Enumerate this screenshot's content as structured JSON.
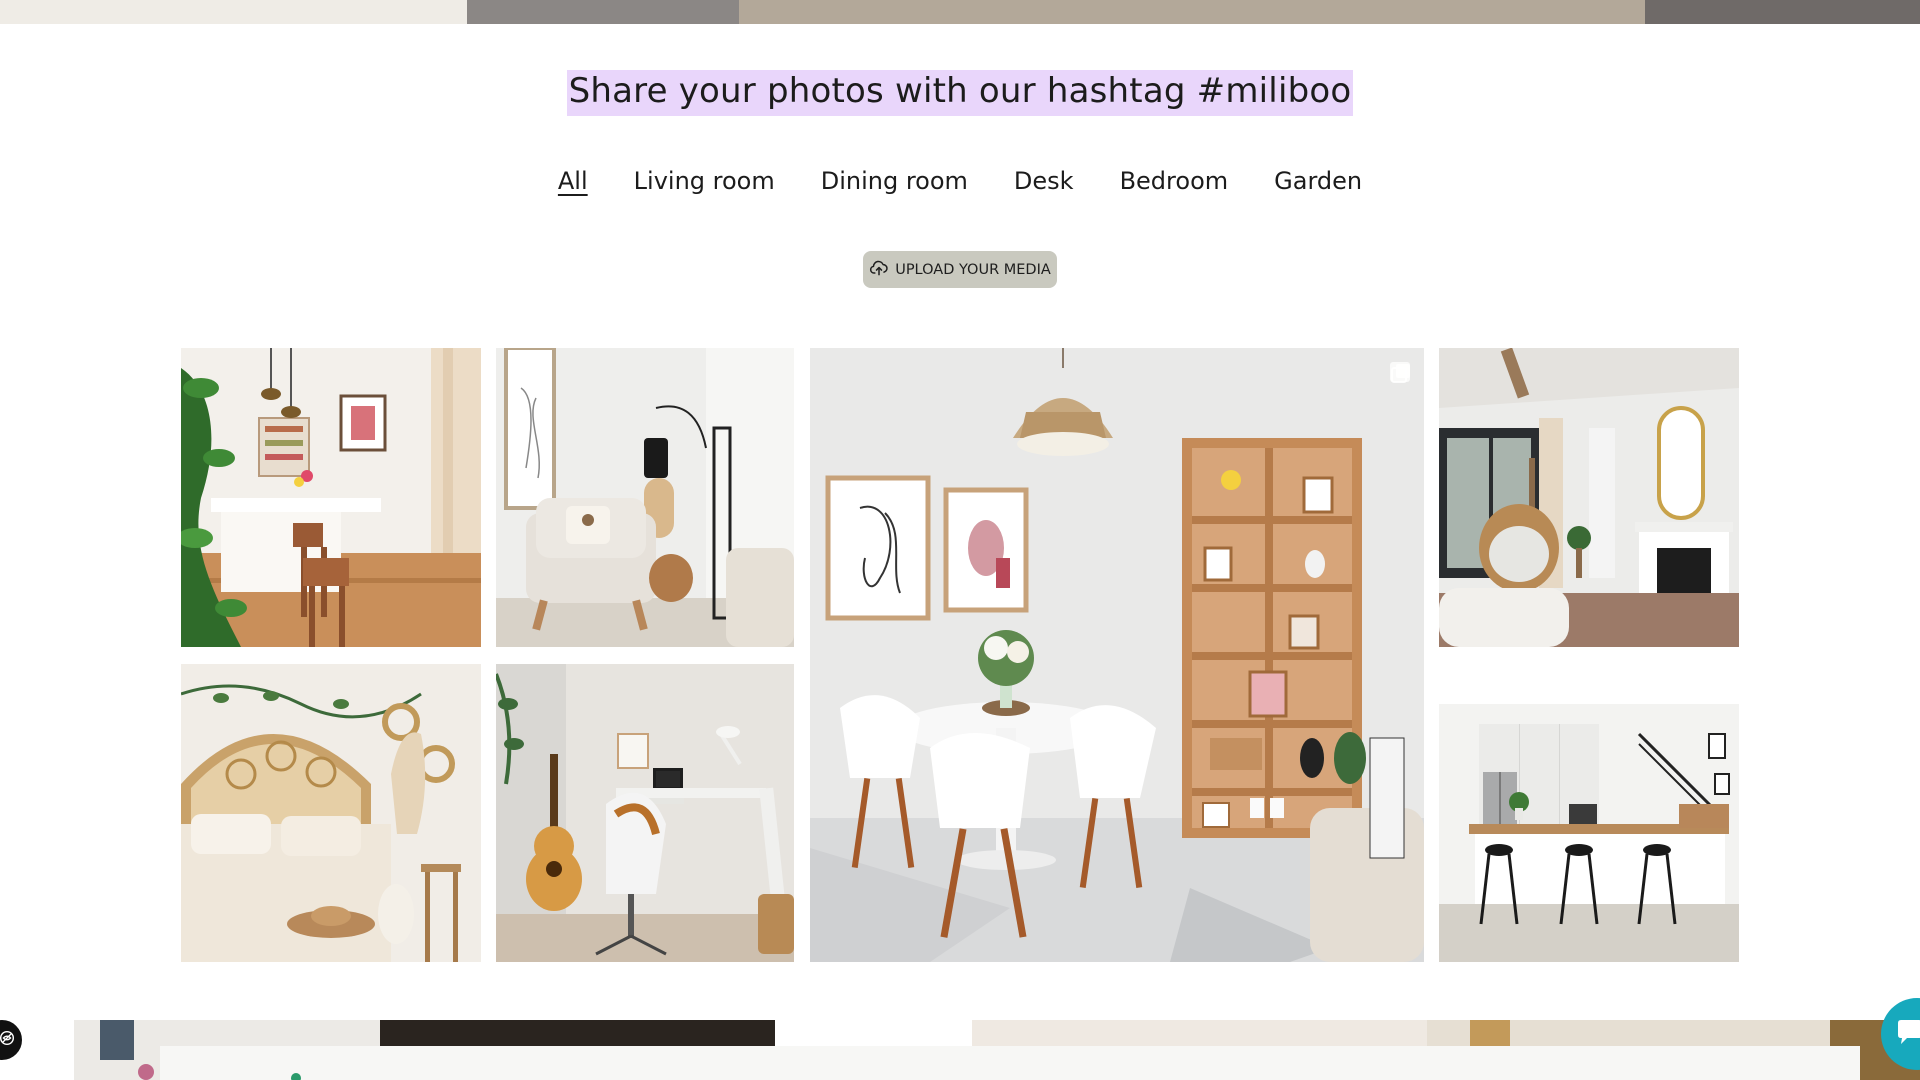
{
  "gallery": {
    "headline": "Share your photos with our hashtag #miliboo",
    "filters": [
      {
        "label": "All",
        "active": true
      },
      {
        "label": "Living room",
        "active": false
      },
      {
        "label": "Dining room",
        "active": false
      },
      {
        "label": "Desk",
        "active": false
      },
      {
        "label": "Bedroom",
        "active": false
      },
      {
        "label": "Garden",
        "active": false
      }
    ],
    "upload_label": "UPLOAD YOUR MEDIA",
    "upload_icon": "cloud-upload-icon",
    "photos": [
      {
        "name": "photo-kitchen-bar",
        "subject": "kitchen breakfast bar with wooden stools"
      },
      {
        "name": "photo-armchair-corner",
        "subject": "reading corner with beige armchair"
      },
      {
        "name": "photo-dining-room",
        "subject": "dining room with round white table and bookshelf",
        "badge_icon": "multi-image-icon"
      },
      {
        "name": "photo-hanging-chair",
        "subject": "living room with hanging egg chair and fireplace"
      },
      {
        "name": "photo-rattan-bedroom",
        "subject": "bedroom with rattan headboard"
      },
      {
        "name": "photo-guitar-desk",
        "subject": "home office desk with guitar"
      },
      {
        "name": "photo-open-kitchen",
        "subject": "open kitchen with black bar stools"
      }
    ]
  },
  "colors": {
    "headline_highlight": "#e9d6fb",
    "upload_button": "#c9c9bf",
    "chat_button": "#17a9bd"
  },
  "widgets": {
    "accessibility_icon": "accessibility-icon",
    "chat_icon": "chat-bubble-icon"
  }
}
